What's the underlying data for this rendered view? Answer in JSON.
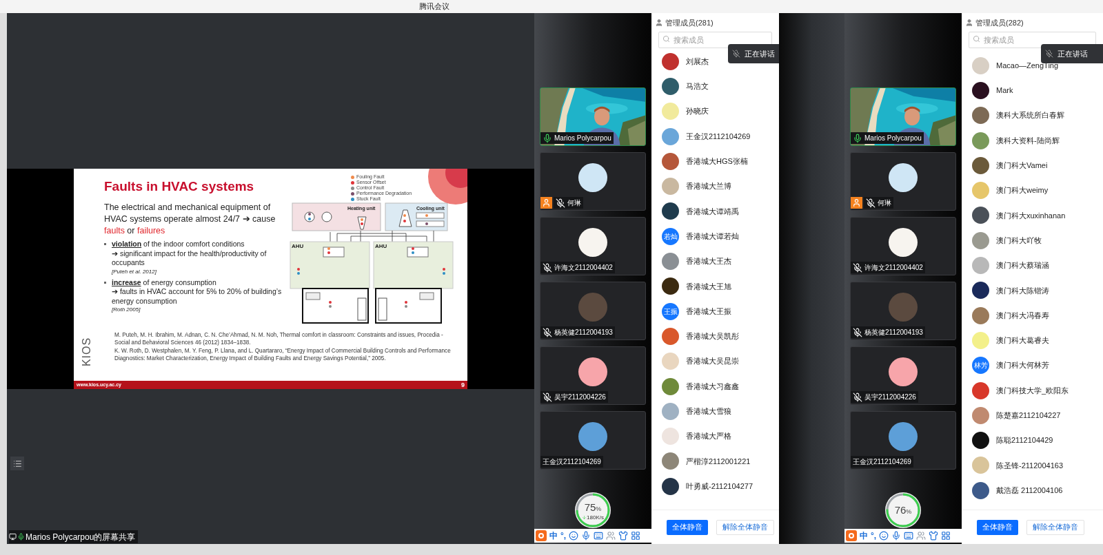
{
  "window": {
    "title": "腾讯会议"
  },
  "share": {
    "caption": "Marios Polycarpou的屏幕共享",
    "slide": {
      "title": "Faults in HVAC systems",
      "lead": [
        {
          "text": "The electrical and mechanical equipment of HVAC systems operate almost 24/7 ➔ cause ",
          "kind": "plain"
        },
        {
          "text": "faults",
          "kind": "accent"
        },
        {
          "text": " or ",
          "kind": "plain"
        },
        {
          "text": "failures",
          "kind": "accent"
        }
      ],
      "bullets": [
        {
          "head": "**violation** of the indoor comfort conditions",
          "detail": "➔ significant impact for the health/productivity of occupants",
          "cite": "[Puteh et al. 2012]"
        },
        {
          "head": "**increase** of energy consumption",
          "detail": "➔ faults in HVAC account for 5% to 20% of building’s energy consumption",
          "cite": "[Roth 2005]"
        }
      ],
      "legend": [
        {
          "label": "Fouling Fault",
          "color": "#f08a4b"
        },
        {
          "label": "Sensor Offset",
          "color": "#e0343a"
        },
        {
          "label": "Control Fault",
          "color": "#8a8a8a"
        },
        {
          "label": "Performance Degradation",
          "color": "#7a4f6a"
        },
        {
          "label": "Stuck Fault",
          "color": "#2e8fc4"
        }
      ],
      "diagram_labels": [
        "Heating unit",
        "Cooling unit",
        "AHU",
        "AHU"
      ],
      "references": [
        "M. Puteh, M. H. Ibrahim, M. Adnan, C. N. Che’Ahmad, N. M. Noh, Thermal comfort in classroom: Constraints and issues, Procedia - Social and Behavioral Sciences 46 (2012) 1834–1838.",
        "K. W. Roth, D. Westphalen, M. Y. Feng, P. Llana, and L. Quartararo, “Energy Impact of Commercial Building Controls and Performance Diagnostics: Market Characterization, Energy Impact of Building Faults and Energy Savings Potential,” 2005."
      ],
      "logo": "KIOS",
      "url": "www.kios.ucy.ac.cy",
      "page": "9"
    }
  },
  "panels": [
    {
      "header": "管理成员(281)",
      "search_placeholder": "搜索成员",
      "speaking": "正在讲话",
      "videos": [
        {
          "kind": "video",
          "name": "Marios Polycarpou",
          "mic_shown": true,
          "muted": false,
          "host": false
        },
        {
          "kind": "avatar",
          "name": "何琳",
          "mic_shown": true,
          "muted": true,
          "host": true,
          "color": "#cfe6f5"
        },
        {
          "kind": "avatar",
          "name": "许海文2112004402",
          "mic_shown": true,
          "muted": true,
          "host": false,
          "color": "#f7f4ef"
        },
        {
          "kind": "avatar",
          "name": "杨英健2112004193",
          "mic_shown": true,
          "muted": true,
          "host": false,
          "color": "#5b4a3f"
        },
        {
          "kind": "avatar",
          "name": "吴宇2112004226",
          "mic_shown": true,
          "muted": true,
          "host": false,
          "color": "#f7a5aa"
        },
        {
          "kind": "avatar",
          "name": "王金汉2112104269",
          "mic_shown": false,
          "host": false,
          "color": "#5d9fd8"
        }
      ],
      "members": [
        {
          "name": "刘展杰",
          "color": "#c0312e"
        },
        {
          "name": "马浩文",
          "color": "#2f5d6a"
        },
        {
          "name": "孙晓庆",
          "color": "#f1ea9c"
        },
        {
          "name": "王金汉2112104269",
          "color": "#6aa6d9"
        },
        {
          "name": "香港城大HGS张楠",
          "color": "#b5573a"
        },
        {
          "name": "香港城大兰博",
          "color": "#c9b8a0"
        },
        {
          "name": "香港城大谭靖禹",
          "color": "#1f3b4d"
        },
        {
          "name": "香港城大谭若灿",
          "color": "#1677ff",
          "avatar_text": "若灿"
        },
        {
          "name": "香港城大王杰",
          "color": "#8a8f94"
        },
        {
          "name": "香港城大王旭",
          "color": "#3b2a10"
        },
        {
          "name": "香港城大王振",
          "color": "#1677ff",
          "avatar_text": "王振"
        },
        {
          "name": "香港城大吴凯彤",
          "color": "#d9582b"
        },
        {
          "name": "香港城大吴昆崇",
          "color": "#e9d6bf"
        },
        {
          "name": "香港城大习鑫鑫",
          "color": "#6f8a3a"
        },
        {
          "name": "香港城大雪狼",
          "color": "#9fb1c2"
        },
        {
          "name": "香港城大严格",
          "color": "#eee4df"
        },
        {
          "name": "严楷淳2112001221",
          "color": "#8d8678"
        },
        {
          "name": "叶勇威-2112104277",
          "color": "#243447"
        }
      ],
      "buttons": [
        {
          "label": "全体静音",
          "kind": "primary"
        },
        {
          "label": "解除全体静音",
          "kind": "secondary"
        }
      ],
      "widget": {
        "percent": "75",
        "unit": "%",
        "reading": "180K/s"
      },
      "ime": [
        "中",
        "°,"
      ]
    },
    {
      "header": "管理成员(282)",
      "search_placeholder": "搜索成员",
      "speaking": "正在讲话",
      "videos": [
        {
          "kind": "video",
          "name": "Marios Polycarpou",
          "mic_shown": true,
          "muted": false,
          "host": false
        },
        {
          "kind": "avatar",
          "name": "何琳",
          "mic_shown": true,
          "muted": true,
          "host": true,
          "color": "#cfe6f5"
        },
        {
          "kind": "avatar",
          "name": "许海文2112004402",
          "mic_shown": true,
          "muted": true,
          "host": false,
          "color": "#f7f4ef"
        },
        {
          "kind": "avatar",
          "name": "杨英健2112004193",
          "mic_shown": true,
          "muted": true,
          "host": false,
          "color": "#5b4a3f"
        },
        {
          "kind": "avatar",
          "name": "吴宇2112004226",
          "mic_shown": true,
          "muted": true,
          "host": false,
          "color": "#f7a5aa"
        },
        {
          "kind": "avatar",
          "name": "王金汉2112104269",
          "mic_shown": false,
          "host": false,
          "color": "#5d9fd8"
        }
      ],
      "members": [
        {
          "name": "Macao—ZengTing",
          "color": "#d8cfc4"
        },
        {
          "name": "Mark",
          "color": "#2a1020"
        },
        {
          "name": "澳科大系统所白春辉",
          "color": "#7d6a55"
        },
        {
          "name": "澳科大资料-陆尚辉",
          "color": "#7a9a5a"
        },
        {
          "name": "澳门科大Vamei",
          "color": "#6b5a3a"
        },
        {
          "name": "澳门科大weimy",
          "color": "#e6c66a"
        },
        {
          "name": "澳门科大xuxinhanan",
          "color": "#4a5058"
        },
        {
          "name": "澳门科大吖牧",
          "color": "#9a9a90"
        },
        {
          "name": "澳门科大蔡瑞涵",
          "color": "#b8b8b8"
        },
        {
          "name": "澳门科大陈锴涛",
          "color": "#1a2a5a"
        },
        {
          "name": "澳门科大冯春寿",
          "color": "#9a7a5a"
        },
        {
          "name": "澳门科大葛睿夫",
          "color": "#f3f08a"
        },
        {
          "name": "澳门科大何林芳",
          "color": "#1677ff",
          "avatar_text": "林芳"
        },
        {
          "name": "澳门科技大学_欧阳东",
          "color": "#d8382a"
        },
        {
          "name": "陈楚嘉2112104227",
          "color": "#c08a70"
        },
        {
          "name": "陈聪2112104429",
          "color": "#111111"
        },
        {
          "name": "陈圣锋-2112004163",
          "color": "#d9c49a"
        },
        {
          "name": "戴浩磊  2112004106",
          "color": "#3d5a8a"
        }
      ],
      "buttons": [
        {
          "label": "全体静音",
          "kind": "primary"
        },
        {
          "label": "解除全体静音",
          "kind": "secondary"
        }
      ],
      "widget": {
        "percent": "76",
        "unit": "%"
      },
      "ime": [
        "中",
        "°,"
      ]
    }
  ]
}
